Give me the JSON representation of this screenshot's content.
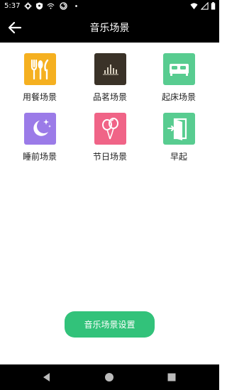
{
  "status_bar": {
    "time": "5:37"
  },
  "toolbar": {
    "title": "音乐场景"
  },
  "scenes": [
    {
      "label": "用餐场景",
      "icon": "dining-icon",
      "color": "#f5b020"
    },
    {
      "label": "品茗场景",
      "icon": "tea-equalizer-icon",
      "color": "#3a3228"
    },
    {
      "label": "起床场景",
      "icon": "bed-icon",
      "color": "#58cc90"
    },
    {
      "label": "睡前场景",
      "icon": "moon-stars-icon",
      "color": "#9b7be8"
    },
    {
      "label": "节日场景",
      "icon": "balloons-icon",
      "color": "#f06487"
    },
    {
      "label": "早起",
      "icon": "door-enter-icon",
      "color": "#58cc90"
    }
  ],
  "settings_button": {
    "label": "音乐场景设置",
    "color": "#32c27a"
  }
}
